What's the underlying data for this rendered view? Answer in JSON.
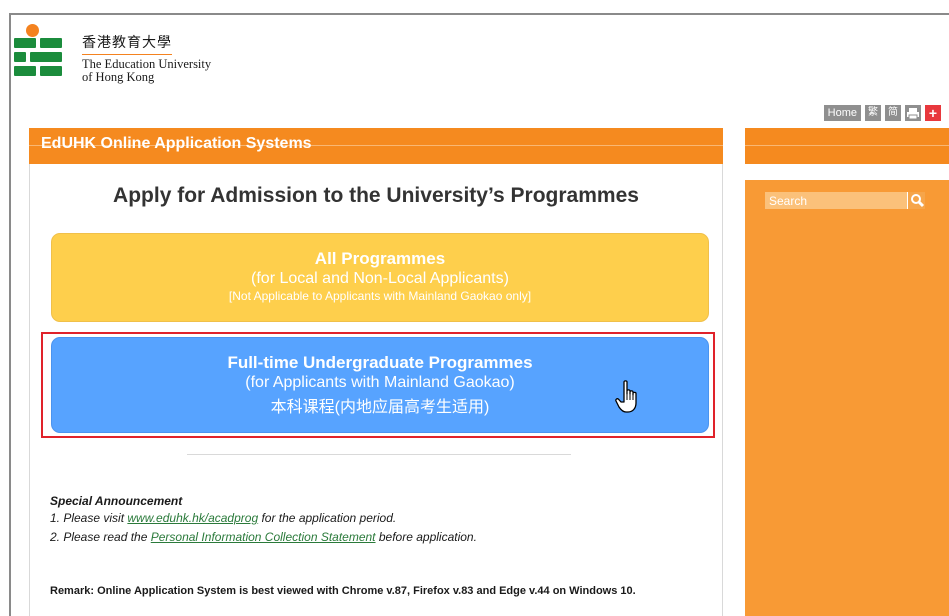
{
  "logo": {
    "zh": "香港教育大學",
    "en_line1": "The Education University",
    "en_line2": "of Hong Kong",
    "brand_orange": "#f4821f",
    "brand_green": "#1b8c3c"
  },
  "util_bar": {
    "home": "Home",
    "traditional": "繁",
    "simplified": "简",
    "print_icon": "print-icon",
    "plus_icon": "plus-icon"
  },
  "header": {
    "title": "EdUHK Online Application Systems"
  },
  "sidebar": {
    "search_placeholder": "Search",
    "search_icon": "search-icon"
  },
  "main": {
    "title": "Apply for Admission to the University’s Programmes",
    "all_programmes": {
      "line1": "All Programmes",
      "line2": "(for Local and Non-Local Applicants)",
      "line3": "[Not Applicable to Applicants with Mainland Gaokao only]",
      "color": "#fecf4c"
    },
    "undergraduate": {
      "line1": "Full-time Undergraduate Programmes",
      "line2": "(for Applicants with Mainland Gaokao)",
      "line3": "本科课程(内地应届高考生适用)",
      "color": "#57a3ff"
    }
  },
  "announcement": {
    "heading": "Special Announcement",
    "item1_prefix": "1. Please visit ",
    "item1_link": "www.eduhk.hk/acadprog",
    "item1_suffix": " for the application period.",
    "item2_prefix": "2. Please read the ",
    "item2_link": "Personal Information Collection Statement",
    "item2_suffix": " before application."
  },
  "remark": "Remark: Online Application System is best viewed with Chrome v.87, Firefox v.83 and Edge v.44 on Windows 10."
}
